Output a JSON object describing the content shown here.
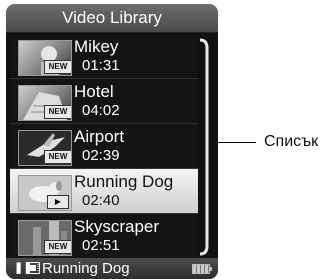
{
  "header": {
    "title": "Video Library"
  },
  "items": [
    {
      "title": "Mikey",
      "time": "01:31",
      "badge": "NEW",
      "selected": false,
      "thumb_icon": "child-photo-icon"
    },
    {
      "title": "Hotel",
      "time": "04:02",
      "badge": "NEW",
      "selected": false,
      "thumb_icon": "building-photo-icon"
    },
    {
      "title": "Airport",
      "time": "02:39",
      "badge": "NEW",
      "selected": false,
      "thumb_icon": "airplane-photo-icon"
    },
    {
      "title": "Running Dog",
      "time": "02:40",
      "badge": "",
      "selected": true,
      "thumb_icon": "dog-photo-icon"
    },
    {
      "title": "Skyscraper",
      "time": "02:51",
      "badge": "NEW",
      "selected": false,
      "thumb_icon": "skyscraper-photo-icon"
    }
  ],
  "status": {
    "now_playing": "Running Dog",
    "state_icon": "pause-icon",
    "media_icon": "film-icon",
    "battery_icon": "battery-icon"
  },
  "callout": {
    "label": "Списък"
  },
  "colors": {
    "selected_bg": "#e6e6e6",
    "list_bg": "#141414",
    "header_bg": "#5a5a5a"
  }
}
